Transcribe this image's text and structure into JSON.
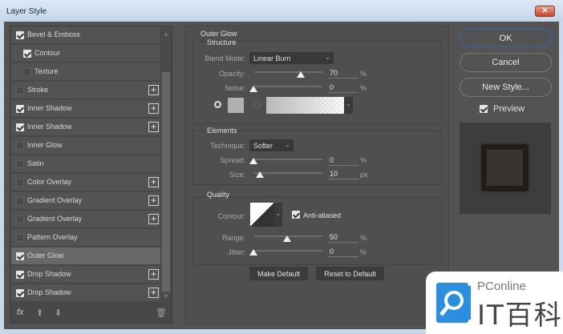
{
  "window": {
    "title": "Layer Style",
    "close": "✕"
  },
  "styles": [
    {
      "label": "Bevel & Emboss",
      "checked": true,
      "indent": false,
      "plus": false
    },
    {
      "label": "Contour",
      "checked": true,
      "indent": true,
      "plus": false
    },
    {
      "label": "Texture",
      "checked": false,
      "indent": true,
      "plus": false
    },
    {
      "label": "Stroke",
      "checked": false,
      "indent": false,
      "plus": true
    },
    {
      "label": "Inner Shadow",
      "checked": true,
      "indent": false,
      "plus": true
    },
    {
      "label": "Inner Shadow",
      "checked": true,
      "indent": false,
      "plus": true
    },
    {
      "label": "Inner Glow",
      "checked": false,
      "indent": false,
      "plus": false
    },
    {
      "label": "Satin",
      "checked": false,
      "indent": false,
      "plus": false
    },
    {
      "label": "Color Overlay",
      "checked": false,
      "indent": false,
      "plus": true
    },
    {
      "label": "Gradient Overlay",
      "checked": false,
      "indent": false,
      "plus": true
    },
    {
      "label": "Gradient Overlay",
      "checked": false,
      "indent": false,
      "plus": true
    },
    {
      "label": "Pattern Overlay",
      "checked": false,
      "indent": false,
      "plus": false
    },
    {
      "label": "Outer Glow",
      "checked": true,
      "indent": false,
      "plus": false,
      "selected": true
    },
    {
      "label": "Drop Shadow",
      "checked": true,
      "indent": false,
      "plus": true
    },
    {
      "label": "Drop Shadow",
      "checked": true,
      "indent": false,
      "plus": true
    }
  ],
  "footer": {
    "fx": "fx"
  },
  "panel": {
    "title": "Outer Glow",
    "structure": {
      "title": "Structure",
      "blend_label": "Blend Mode:",
      "blend_value": "Linear Burn",
      "opacity_label": "Opacity:",
      "opacity": "70",
      "opacity_unit": "%",
      "noise_label": "Noise:",
      "noise": "0",
      "noise_unit": "%",
      "glow_color": "#b0b0b0"
    },
    "elements": {
      "title": "Elements",
      "technique_label": "Technique:",
      "technique": "Softer",
      "spread_label": "Spread:",
      "spread": "0",
      "spread_unit": "%",
      "size_label": "Size:",
      "size": "10",
      "size_unit": "px"
    },
    "quality": {
      "title": "Quality",
      "contour_label": "Contour:",
      "anti_aliased": "Anti-aliased",
      "range_label": "Range:",
      "range": "50",
      "range_unit": "%",
      "jitter_label": "Jitter:",
      "jitter": "0",
      "jitter_unit": "%"
    },
    "make_default": "Make Default",
    "reset_default": "Reset to Default"
  },
  "right": {
    "ok": "OK",
    "cancel": "Cancel",
    "new_style": "New Style...",
    "preview": "Preview"
  },
  "watermark": {
    "brand": "PConline",
    "name": "IT百科"
  }
}
